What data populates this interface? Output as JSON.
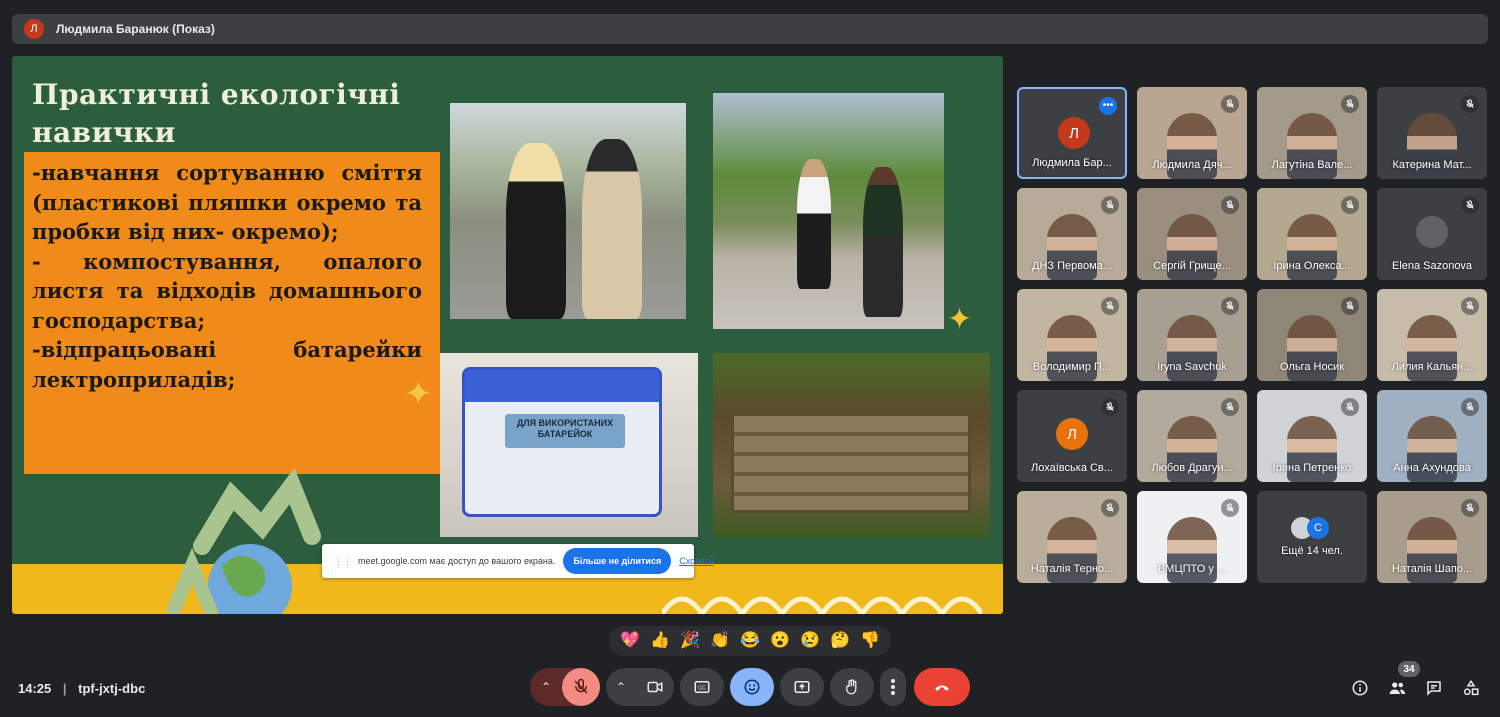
{
  "presenter_bar": {
    "avatar_letter": "Л",
    "title": "Людмила Баранюк (Показ)"
  },
  "slide": {
    "title": "Практичні екологічні навички",
    "bullets": [
      "-навчання сортуванню сміття (пластикові пляшки окремо та пробки від них- окремо);",
      "- компостування, опалого листя та відходів домашнього господарства;",
      "-відпрацьовані батарейки лектроприладів;"
    ],
    "battery_box_label": "ДЛЯ ВИКОРИСТАНИХ БАТАРЕЙОК"
  },
  "share_notice": {
    "text": "meet.google.com має доступ до вашого екрана.",
    "stop_button": "Більше не ділитися",
    "hide_link": "Сховати"
  },
  "participants": [
    {
      "name": "Людмила Бар...",
      "avatar": "Л",
      "avatar_color": "#c5381c",
      "active": true
    },
    {
      "name": "Людмила Дяч..."
    },
    {
      "name": "Лагутіна Вале..."
    },
    {
      "name": "Катерина Мат..."
    },
    {
      "name": "ДНЗ Первома..."
    },
    {
      "name": "Сергій Грище..."
    },
    {
      "name": "Ірина Олекса..."
    },
    {
      "name": "Elena Sazonova"
    },
    {
      "name": "Володимир П..."
    },
    {
      "name": "Iryna Savchuk"
    },
    {
      "name": "Ольга Носик"
    },
    {
      "name": "Лилия Кальян..."
    },
    {
      "name": "Лохаївська Св...",
      "avatar": "Л",
      "avatar_color": "#e8710a"
    },
    {
      "name": "Любов Драгун..."
    },
    {
      "name": "Ірина Петренко"
    },
    {
      "name": "Анна Ахундова"
    },
    {
      "name": "Наталія Терно..."
    },
    {
      "name": "ВМЦПТО у ..."
    },
    {
      "name": "Ещё 14 чел.",
      "avatar": "С",
      "avatar_color": "#1a73e8"
    },
    {
      "name": "Наталія Шапо..."
    }
  ],
  "reactions": [
    "💖",
    "👍",
    "🎉",
    "👏",
    "😂",
    "😮",
    "😢",
    "🤔",
    "👎"
  ],
  "bottom": {
    "time": "14:25",
    "separator": "|",
    "meeting_code": "tpf-jxtj-dbc",
    "people_count": "34"
  },
  "colors": {
    "background": "#202124",
    "slide_green": "#2c5d3f",
    "orange": "#f08a18",
    "accent_blue": "#8ab4f8",
    "end_call_red": "#ea4335",
    "mic_off_red": "#f28b82"
  },
  "icons": [
    "mic-off-icon",
    "camera-icon",
    "captions-icon",
    "emoji-icon",
    "present-icon",
    "raise-hand-icon",
    "more-icon",
    "end-call-icon",
    "info-icon",
    "people-icon",
    "chat-icon",
    "activities-icon"
  ]
}
